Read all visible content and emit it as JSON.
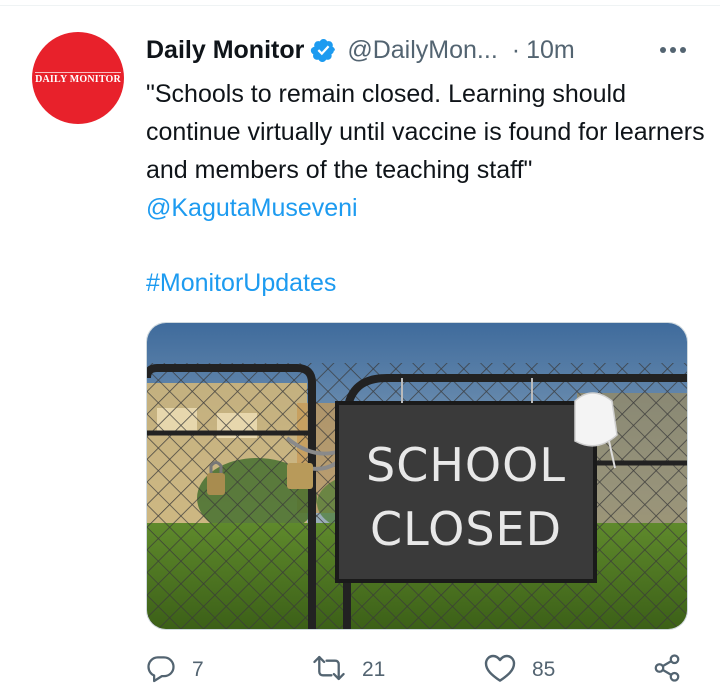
{
  "author": {
    "display_name": "Daily Monitor",
    "handle": "@DailyMon...",
    "separator": "·",
    "timestamp": "10m",
    "avatar_logo_text": "DAILY MONITOR",
    "verified": true
  },
  "tweet": {
    "text": "\"Schools to remain closed. Learning should continue virtually until vaccine is found for learners and members of the teaching staff\"",
    "mention": "@KagutaMuseveni",
    "hashtag": "#MonitorUpdates"
  },
  "media": {
    "sign_line1": "SCHOOL",
    "sign_line2": "CLOSED"
  },
  "actions": {
    "replies": "7",
    "retweets": "21",
    "likes": "85"
  },
  "icons": {
    "verified": "verified-badge-icon",
    "more": "more-icon",
    "reply": "reply-icon",
    "retweet": "retweet-icon",
    "like": "heart-icon",
    "share": "share-icon"
  },
  "colors": {
    "accent": "#1d9bf0",
    "secondary_text": "#536471",
    "avatar_bg": "#e8212b"
  }
}
